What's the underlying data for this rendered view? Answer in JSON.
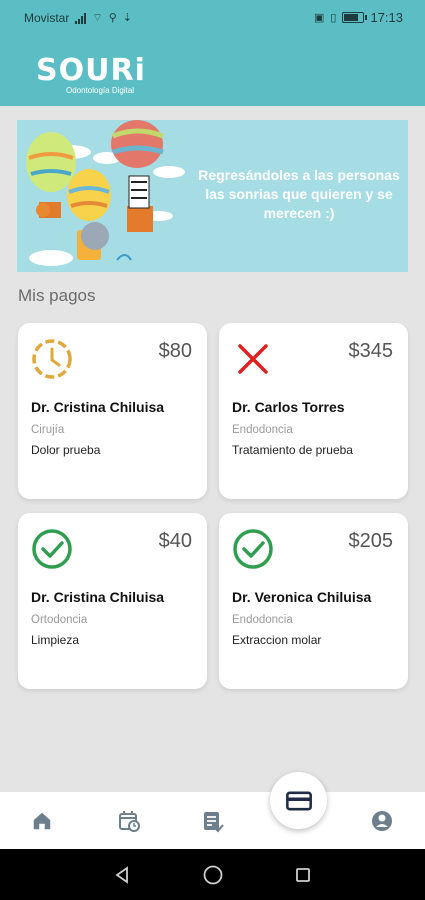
{
  "status_bar": {
    "carrier": "Movistar",
    "time": "17:13"
  },
  "header": {
    "logo_text": "SOURi",
    "logo_subtitle": "Odontología Digital"
  },
  "banner": {
    "text": "Regresándoles a las personas las sonrias que quieren y se merecen :)"
  },
  "section": {
    "title": "Mis pagos"
  },
  "payments": [
    {
      "status": "pending",
      "amount": "$80",
      "doctor": "Dr. Cristina Chiluisa",
      "specialty": "Cirujía",
      "description": "Dolor prueba",
      "status_color": "#e0a83a"
    },
    {
      "status": "rejected",
      "amount": "$345",
      "doctor": "Dr. Carlos Torres",
      "specialty": "Endodoncia",
      "description": "Tratamiento de prueba",
      "status_color": "#e02020"
    },
    {
      "status": "paid",
      "amount": "$40",
      "doctor": "Dr. Cristina Chiluisa",
      "specialty": "Ortodoncia",
      "description": "Limpieza",
      "status_color": "#2f9e4f"
    },
    {
      "status": "paid",
      "amount": "$205",
      "doctor": "Dr. Veronica Chiluisa",
      "specialty": "Endodoncia",
      "description": "Extraccion molar",
      "status_color": "#2f9e4f"
    }
  ],
  "bottom_nav": {
    "items": [
      {
        "icon": "home-icon"
      },
      {
        "icon": "calendar-icon"
      },
      {
        "icon": "records-icon"
      },
      {
        "icon": "payments-card-icon",
        "active": true
      },
      {
        "icon": "profile-icon"
      }
    ],
    "icon_color": "#6d7f8c",
    "active_color": "#1f2e46"
  },
  "colors": {
    "brand": "#5bbec4",
    "banner": "#a6dde4"
  }
}
